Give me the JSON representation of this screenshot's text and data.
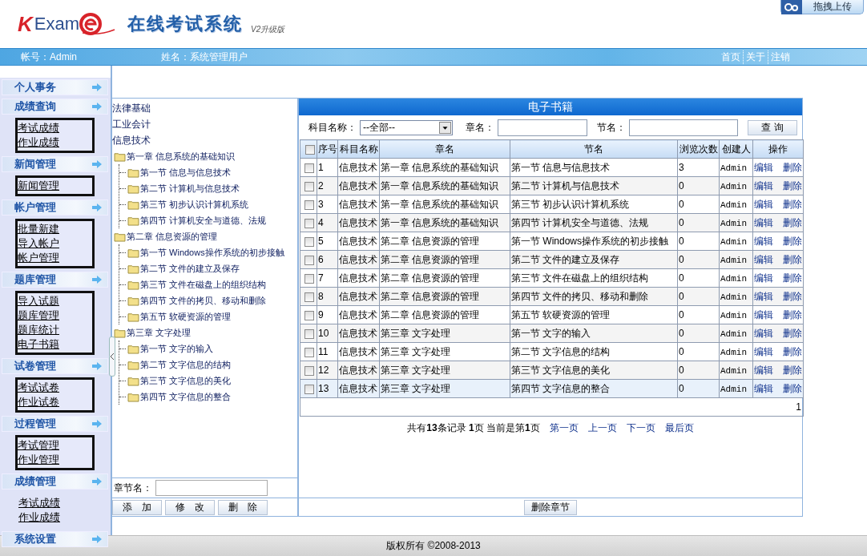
{
  "header": {
    "logo_letter": "K",
    "logo_word": "Exam",
    "title": "在线考试系统",
    "version": "V2升级版",
    "upload_button": "拖拽上传"
  },
  "nav_bar": {
    "account": "帐号：Admin",
    "user_name": "姓名：系统管理用户",
    "links": [
      "首页",
      "关于",
      "注销"
    ]
  },
  "sidebar": {
    "groups": [
      {
        "title": "个人事务"
      },
      {
        "title": "成绩查询",
        "boxed": true,
        "items": [
          "考试成绩",
          "作业成绩"
        ]
      },
      {
        "title": "新闻管理",
        "boxed": true,
        "items": [
          "新闻管理"
        ]
      },
      {
        "title": "帐户管理",
        "boxed": true,
        "items": [
          "批量新建",
          "导入帐户",
          "帐户管理"
        ]
      },
      {
        "title": "题库管理",
        "boxed": true,
        "items": [
          "导入试题",
          "题库管理",
          "题库统计",
          "电子书籍"
        ]
      },
      {
        "title": "试卷管理",
        "boxed": true,
        "items": [
          "考试试卷",
          "作业试卷"
        ]
      },
      {
        "title": "过程管理",
        "boxed": true,
        "items": [
          "考试管理",
          "作业管理"
        ]
      },
      {
        "title": "成绩管理",
        "boxed": false,
        "items": [
          "考试成绩",
          "作业成绩"
        ]
      },
      {
        "title": "系统设置"
      }
    ]
  },
  "tree": {
    "nodes": [
      {
        "label": "法律基础",
        "kind": "subject"
      },
      {
        "label": "工业会计",
        "kind": "subject"
      },
      {
        "label": "信息技术",
        "kind": "subject"
      },
      {
        "label": "第一章 信息系统的基础知识",
        "kind": "chapter",
        "children": [
          {
            "label": "第一节 信息与信息技术"
          },
          {
            "label": "第二节 计算机与信息技术"
          },
          {
            "label": "第三节 初步认识计算机系统"
          },
          {
            "label": "第四节 计算机安全与道德、法规"
          }
        ]
      },
      {
        "label": "第二章 信息资源的管理",
        "kind": "chapter",
        "children": [
          {
            "label": "第一节 Windows操作系统的初步接触"
          },
          {
            "label": "第二节 文件的建立及保存"
          },
          {
            "label": "第三节 文件在磁盘上的组织结构"
          },
          {
            "label": "第四节 文件的拷贝、移动和删除"
          },
          {
            "label": "第五节 软硬资源的管理"
          }
        ]
      },
      {
        "label": "第三章 文字处理",
        "kind": "chapter",
        "children": [
          {
            "label": "第一节 文字的输入"
          },
          {
            "label": "第二节 文字信息的结构"
          },
          {
            "label": "第三节 文字信息的美化"
          },
          {
            "label": "第四节 文字信息的整合"
          }
        ]
      }
    ],
    "name_label": "章节名：",
    "buttons": [
      "添　加",
      "修　改",
      "删　除"
    ]
  },
  "ebooks": {
    "title": "电子书籍",
    "filters": {
      "subject_label": "科目名称：",
      "subject_value": "--全部--",
      "chapter_label": "章名：",
      "section_label": "节名：",
      "query_button": "查 询"
    },
    "all_checked": false,
    "columns": [
      "序号",
      "科目名称",
      "章名",
      "节名",
      "浏览次数",
      "创建人",
      "操作"
    ],
    "rows": [
      {
        "no": "1",
        "subject": "信息技术",
        "chapter": "第一章 信息系统的基础知识",
        "section": "第一节 信息与信息技术",
        "views": "3",
        "creator": "Admin",
        "edit": "编辑",
        "delete": "删除",
        "checked": false,
        "selected": false
      },
      {
        "no": "2",
        "subject": "信息技术",
        "chapter": "第一章 信息系统的基础知识",
        "section": "第二节 计算机与信息技术",
        "views": "0",
        "creator": "Admin",
        "edit": "编辑",
        "delete": "删除",
        "checked": false,
        "selected": false
      },
      {
        "no": "3",
        "subject": "信息技术",
        "chapter": "第一章 信息系统的基础知识",
        "section": "第三节 初步认识计算机系统",
        "views": "0",
        "creator": "Admin",
        "edit": "编辑",
        "delete": "删除",
        "checked": false,
        "selected": false
      },
      {
        "no": "4",
        "subject": "信息技术",
        "chapter": "第一章 信息系统的基础知识",
        "section": "第四节 计算机安全与道德、法规",
        "views": "0",
        "creator": "Admin",
        "edit": "编辑",
        "delete": "删除",
        "checked": false,
        "selected": false
      },
      {
        "no": "5",
        "subject": "信息技术",
        "chapter": "第二章 信息资源的管理",
        "section": "第一节 Windows操作系统的初步接触",
        "views": "0",
        "creator": "Admin",
        "edit": "编辑",
        "delete": "删除",
        "checked": false,
        "selected": false
      },
      {
        "no": "6",
        "subject": "信息技术",
        "chapter": "第二章 信息资源的管理",
        "section": "第二节 文件的建立及保存",
        "views": "0",
        "creator": "Admin",
        "edit": "编辑",
        "delete": "删除",
        "checked": false,
        "selected": false
      },
      {
        "no": "7",
        "subject": "信息技术",
        "chapter": "第二章 信息资源的管理",
        "section": "第三节 文件在磁盘上的组织结构",
        "views": "0",
        "creator": "Admin",
        "edit": "编辑",
        "delete": "删除",
        "checked": false,
        "selected": false
      },
      {
        "no": "8",
        "subject": "信息技术",
        "chapter": "第二章 信息资源的管理",
        "section": "第四节 文件的拷贝、移动和删除",
        "views": "0",
        "creator": "Admin",
        "edit": "编辑",
        "delete": "删除",
        "checked": false,
        "selected": false
      },
      {
        "no": "9",
        "subject": "信息技术",
        "chapter": "第二章 信息资源的管理",
        "section": "第五节 软硬资源的管理",
        "views": "0",
        "creator": "Admin",
        "edit": "编辑",
        "delete": "删除",
        "checked": false,
        "selected": false
      },
      {
        "no": "10",
        "subject": "信息技术",
        "chapter": "第三章 文字处理",
        "section": "第一节 文字的输入",
        "views": "0",
        "creator": "Admin",
        "edit": "编辑",
        "delete": "删除",
        "checked": false,
        "selected": false
      },
      {
        "no": "11",
        "subject": "信息技术",
        "chapter": "第三章 文字处理",
        "section": "第二节 文字信息的结构",
        "views": "0",
        "creator": "Admin",
        "edit": "编辑",
        "delete": "删除",
        "checked": false,
        "selected": false
      },
      {
        "no": "12",
        "subject": "信息技术",
        "chapter": "第三章 文字处理",
        "section": "第三节 文字信息的美化",
        "views": "0",
        "creator": "Admin",
        "edit": "编辑",
        "delete": "删除",
        "checked": false,
        "selected": false
      },
      {
        "no": "13",
        "subject": "信息技术",
        "chapter": "第三章 文字处理",
        "section": "第四节 文字信息的整合",
        "views": "0",
        "creator": "Admin",
        "edit": "编辑",
        "delete": "删除",
        "checked": false,
        "selected": true
      }
    ],
    "page_number": "1",
    "summary": "共有**13**条记录 **1**页 当前是第**1**页",
    "page_links": [
      "第一页",
      "上一页",
      "下一页",
      "最后页"
    ],
    "delete_button": "删除章节"
  },
  "footer": {
    "copyright": "版权所有 ©2008-2013"
  }
}
